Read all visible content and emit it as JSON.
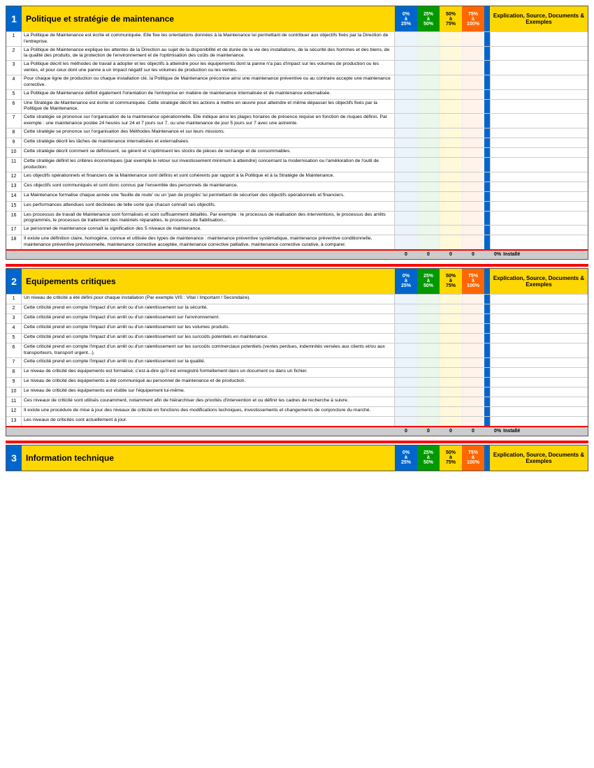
{
  "sections": [
    {
      "number": "1",
      "title": "Politique et stratégie de maintenance",
      "explication": "Explication, Source, Documents & Exemples",
      "items": [
        "La Politique de Maintenance est écrite et communiquée. Elle fixe les orientations données à la Maintenance lui permettant de contribuer aux objectifs fixés par la Direction de l'entreprise.",
        "La Politique de Maintenance explique les attentes de la Direction au sujet de la disponibilité et de durée de la vie des installations, de la sécurité des hommes et des biens, de la qualité des produits, de la protection de l'environnement et de l'optimisation des coûts de maintenance.",
        "La Politique décrit les méthodes de travail à adopter et les objectifs à atteindre pour les équipements dont la panne n'a pas d'impact sur les volumes de production ou les ventes, et pour ceux dont une panne a un impact négatif sur les volumes de production ou les ventes.",
        "Pour chaque ligne de production ou chaque installation clé, la Politique de Maintenance préconise ainsi une maintenance préventive ou au contraire accepte une maintenance corrective.",
        "La Politique de Maintenance définit également l'orientation de l'entreprise en matière de maintenance internalisée et de maintenance externalisée.",
        "Une Stratégie de Maintenance est écrite et communiquée. Cette stratégie décrit les actions à mettre en œuvre pour atteindre et même dépasser les objectifs fixés par la Politique de Maintenance.",
        "Cette stratégie se prononce sur l'organisation de la maintenance opérationnelle. Elle indique ainsi les plages horaires de présence requise en fonction de risques définis. Par exemple : une maintenance postée 24 heures sur 24 et 7 jours sur 7, ou une maintenance de jour 5 jours sur 7 avec une astreinte.",
        "Cette stratégie se prononce sur l'organisation des Méthodes Maintenance et sur leurs missions.",
        "Cette stratégie décrit les tâches de maintenance internalisées et externalisées.",
        "Cette stratégie décrit comment se définissent, se gèrent et s'optimisent les stocks de pièces de rechange et de consommables.",
        "Cette stratégie définit les critères économiques (par exemple le retour sur investissement minimum à atteindre) concernant la modernisation ou l'amélioration de l'outil de production.",
        "Les objectifs opérationnels et financiers de la Maintenance sont définis et sont cohérents par rapport à la Politique et à la Stratégie de Maintenance.",
        "Ces objectifs sont communiqués et sont donc connus par l'ensemble des personnels de maintenance.",
        "La Maintenance formalise chaque année une 'feuille de route' ou un 'pan de progrès' lui permettant de sécuriser des objectifs opérationnels et financiers.",
        "Les performances attendues sont déclinées de telle sorte que chacun connaît ses objectifs.",
        "Les processus de travail de Maintenance sont formalisés et sont suffisamment détaillés. Par exemple : le processus de réalisation des interventions, le processus des arrêts programmés, le processus de traitement des matériels réparables, le processus de fiabilisation...",
        "Le personnel de maintenance connaît la signification des 5 niveaux de maintenance.",
        "Il existe une définition claire, homogène, connue et utilisée des types de maintenance : maintenance préventive systématique, maintenance préventive conditionnelle, maintenance préventive prévisionnelle, maintenance corrective acceptée, maintenance corrective palliative, maintenance corrective curative, à comparer."
      ],
      "footer_values": [
        "0",
        "0",
        "0",
        "0"
      ],
      "footer_pct": "0%",
      "footer_label": "Installé"
    },
    {
      "number": "2",
      "title": "Equipements critiques",
      "explication": "Explication, Source, Documents & Exemples",
      "items": [
        "Un niveau de criticité a été défini pour chaque installation (Par exemple VIS : Vital / Important / Secondaire).",
        "Cette criticité prend en compte l'impact d'un arrêt ou d'un ralentissement sur la sécurité.",
        "Cette criticité prend en compte l'impact d'un arrêt ou d'un ralentissement sur l'environnement.",
        "Cette criticité prend en compte l'impact d'un arrêt ou d'un ralentissement sur les volumes produits.",
        "Cette criticité prend en compte l'impact d'un arrêt ou d'un ralentissement sur les surcoûts potentiels en maintenance.",
        "Cette criticité prend en compte l'impact d'un arrêt ou d'un ralentissement sur les surcoûts commerciaux potentiels (ventes perdues, indemnités versées aux clients et/ou aux transporteurs, transport urgent...).",
        "Cette criticité prend en compte l'impact d'un arrêt ou d'un ralentissement sur la qualité.",
        "Le niveau de criticité des équipements est formalisé, c'est-à-dire qu'il est enregistré formellement dans un document ou dans un fichier.",
        "Le niveau de criticité des équipements a été communiqué au personnel de maintenance et de production.",
        "Le niveau de criticité des équipements est visible sur l'équipement lui-même.",
        "Ces niveaux de criticité sont utilisés couramment, notamment afin de hiérarchiser des priorités d'intervention et ou définir les cadres de recherche à suivre.",
        "Il existe une procédure de mise à jour des niveaux de criticité en fonctions des modifications techniques, investissements et changements de conjoncture du marché.",
        "Les niveaux de criticités sont actuellement à jour."
      ],
      "footer_values": [
        "0",
        "0",
        "0",
        "0"
      ],
      "footer_pct": "0%",
      "footer_label": "Installé"
    },
    {
      "number": "3",
      "title": "Information technique",
      "explication": "Explication, Source, Documents & Exemples",
      "items": [],
      "footer_values": [],
      "footer_pct": "",
      "footer_label": ""
    }
  ],
  "score_headers": [
    {
      "label": "0%\nà\n25%",
      "class": "s1"
    },
    {
      "label": "25%\nà\n50%",
      "class": "s2"
    },
    {
      "label": "50%\nà\n75%",
      "class": "s3"
    },
    {
      "label": "75%\nà\n100%",
      "class": "s4"
    }
  ]
}
